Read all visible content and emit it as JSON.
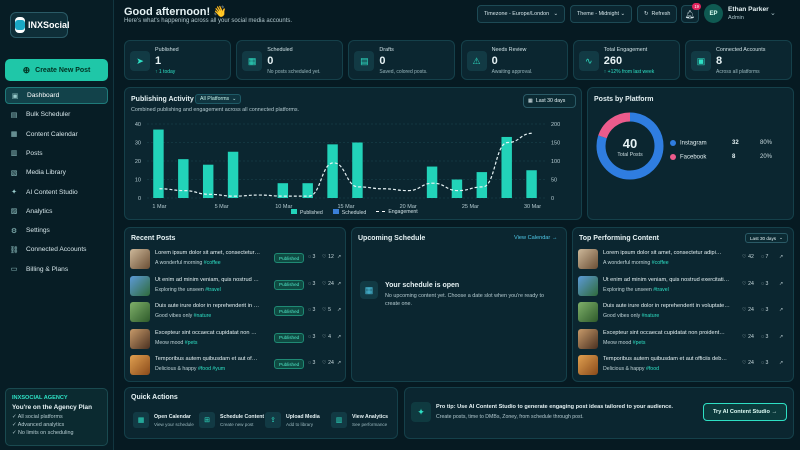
{
  "app": {
    "name": "INXSocial"
  },
  "sidebar": {
    "new_post": "Create New Post",
    "items": [
      {
        "label": "Dashboard",
        "icon": "dashboard-icon"
      },
      {
        "label": "Bulk Scheduler",
        "icon": "bulk-icon"
      },
      {
        "label": "Content Calendar",
        "icon": "calendar-icon"
      },
      {
        "label": "Posts",
        "icon": "posts-icon"
      },
      {
        "label": "Media Library",
        "icon": "media-icon"
      },
      {
        "label": "AI Content Studio",
        "icon": "ai-icon"
      },
      {
        "label": "Analytics",
        "icon": "analytics-icon"
      },
      {
        "label": "Settings",
        "icon": "gear-icon"
      },
      {
        "label": "Connected Accounts",
        "icon": "accounts-icon"
      },
      {
        "label": "Billing & Plans",
        "icon": "billing-icon"
      }
    ],
    "agency": {
      "title": "INXSOCIAL AGENCY",
      "plan": "You're on the Agency Plan",
      "features": [
        "All social platforms",
        "Advanced analytics",
        "No limits on scheduling"
      ]
    }
  },
  "header": {
    "greeting": "Good afternoon! 👋",
    "subtitle": "Here's what's happening across all your social media accounts.",
    "timezone": "Timezone - Europe/London",
    "theme": "Theme - Midnight",
    "refresh": "Refresh",
    "notifications": "19",
    "user": {
      "initials": "EP",
      "name": "Ethan Parker",
      "role": "Admin"
    }
  },
  "stats": [
    {
      "label": "Published",
      "value": "1",
      "sub": "↑ 1 today"
    },
    {
      "label": "Scheduled",
      "value": "0",
      "sub": "No posts scheduled yet."
    },
    {
      "label": "Drafts",
      "value": "0",
      "sub": "Saved, colored posts."
    },
    {
      "label": "Needs Review",
      "value": "0",
      "sub": "Awaiting approval."
    },
    {
      "label": "Total Engagement",
      "value": "260",
      "sub": "↑ +12% from last week"
    },
    {
      "label": "Connected Accounts",
      "value": "8",
      "sub": "Across all platforms"
    }
  ],
  "activity": {
    "title": "Publishing Activity",
    "filter": "All Platforms",
    "subtitle": "Combined publishing and engagement across all connected platforms.",
    "range": "Last 30 days",
    "legend": {
      "published": "Published",
      "scheduled": "Scheduled",
      "engagement": "Engagement"
    }
  },
  "chart_data": {
    "type": "bar",
    "categories": [
      "1 Mar",
      "3 Mar",
      "5 Mar",
      "7 Mar",
      "9 Mar",
      "11 Mar",
      "13 Mar",
      "15 Mar",
      "17 Mar",
      "19 Mar",
      "21 Mar",
      "23 Mar",
      "25 Mar",
      "27 Mar",
      "29 Mar",
      "31 Mar"
    ],
    "tick_labels": [
      "1 Mar",
      "5 Mar",
      "10 Mar",
      "15 Mar",
      "20 Mar",
      "25 Mar",
      "30 Mar"
    ],
    "series": [
      {
        "name": "Published",
        "values": [
          37,
          21,
          18,
          25,
          0,
          8,
          8,
          29,
          30,
          0,
          0,
          17,
          10,
          14,
          33,
          15
        ]
      },
      {
        "name": "Scheduled",
        "values": [
          0,
          0,
          0,
          0,
          0,
          0,
          0,
          0,
          0,
          0,
          0,
          0,
          0,
          0,
          0,
          0
        ]
      },
      {
        "name": "Engagement",
        "values": [
          25,
          20,
          10,
          5,
          8,
          5,
          5,
          95,
          30,
          25,
          20,
          40,
          20,
          30,
          150,
          175
        ]
      }
    ],
    "ylim_left": [
      0,
      40
    ],
    "ylim_right": [
      0,
      200
    ],
    "yticks_left": [
      0,
      10,
      20,
      30,
      40
    ],
    "yticks_right": [
      0,
      50,
      100,
      150,
      200
    ]
  },
  "by_platform": {
    "title": "Posts by Platform",
    "total": "40",
    "total_label": "Total Posts",
    "items": [
      {
        "name": "Instagram",
        "count": "32",
        "pct": "80%",
        "share": 0.8,
        "color": "#2f7de0"
      },
      {
        "name": "Facebook",
        "count": "8",
        "pct": "20%",
        "share": 0.2,
        "color": "#ec5b8c"
      }
    ]
  },
  "recent": {
    "title": "Recent Posts",
    "rows": [
      {
        "title": "Lorem ipsum dolor sit amet, consectetur…",
        "caption": "A wonderful morning",
        "tag": "#coffee",
        "status": "Published",
        "comments": "3",
        "likes": "12"
      },
      {
        "title": "Ut enim ad minim veniam, quis nostrud …",
        "caption": "Exploring the unseen",
        "tag": "#travel",
        "status": "Published",
        "comments": "3",
        "likes": "24"
      },
      {
        "title": "Duis aute irure dolor in reprehenderit in …",
        "caption": "Good vibes only",
        "tag": "#nature",
        "status": "Published",
        "comments": "3",
        "likes": "5"
      },
      {
        "title": "Excepteur sint occaecat cupidatat non …",
        "caption": "Meow mood",
        "tag": "#pets",
        "status": "Published",
        "comments": "3",
        "likes": "4"
      },
      {
        "title": "Temporibus autem quibusdam et aut of…",
        "caption": "Delicious & happy",
        "tag": "#food #yum",
        "status": "Published",
        "comments": "3",
        "likes": "24"
      }
    ]
  },
  "upcoming": {
    "title": "Upcoming Schedule",
    "link": "View Calendar →",
    "empty_title": "Your schedule is open",
    "empty_text": "No upcoming content yet. Choose a date slot when you're ready to create one."
  },
  "top": {
    "title": "Top Performing Content",
    "range": "Last 30 days",
    "rows": [
      {
        "title": "Lorem ipsum dolor sit amet, consectetur adipi…",
        "caption": "A wonderful morning",
        "tag": "#coffee",
        "likes": "42",
        "comments": "7"
      },
      {
        "title": "Ut enim ad minim veniam, quis nostrud exercitati…",
        "caption": "Exploring the unseen",
        "tag": "#travel",
        "likes": "24",
        "comments": "3"
      },
      {
        "title": "Duis aute irure dolor in reprehenderit in voluptate…",
        "caption": "Good vibes only",
        "tag": "#nature",
        "likes": "24",
        "comments": "3"
      },
      {
        "title": "Excepteur sint occaecat cupidatat non proident…",
        "caption": "Meow mood",
        "tag": "#pets",
        "likes": "24",
        "comments": "3"
      },
      {
        "title": "Temporibus autem quibusdam et aut officiis deb…",
        "caption": "Delicious & happy",
        "tag": "#food",
        "likes": "24",
        "comments": "3"
      }
    ]
  },
  "quick": {
    "title": "Quick Actions",
    "items": [
      {
        "label": "Open Calendar",
        "sub": "View your schedule"
      },
      {
        "label": "Schedule Content",
        "sub": "Create new post"
      },
      {
        "label": "Upload Media",
        "sub": "Add to library"
      },
      {
        "label": "View Analytics",
        "sub": "See performance"
      }
    ]
  },
  "tip": {
    "title": "Pro tip: Use AI Content Studio to generate engaging post ideas tailored to your audience.",
    "text": "Create posts, time to DMBs, Zoney, from schedule through post.",
    "button": "Try AI Content Studio →"
  }
}
